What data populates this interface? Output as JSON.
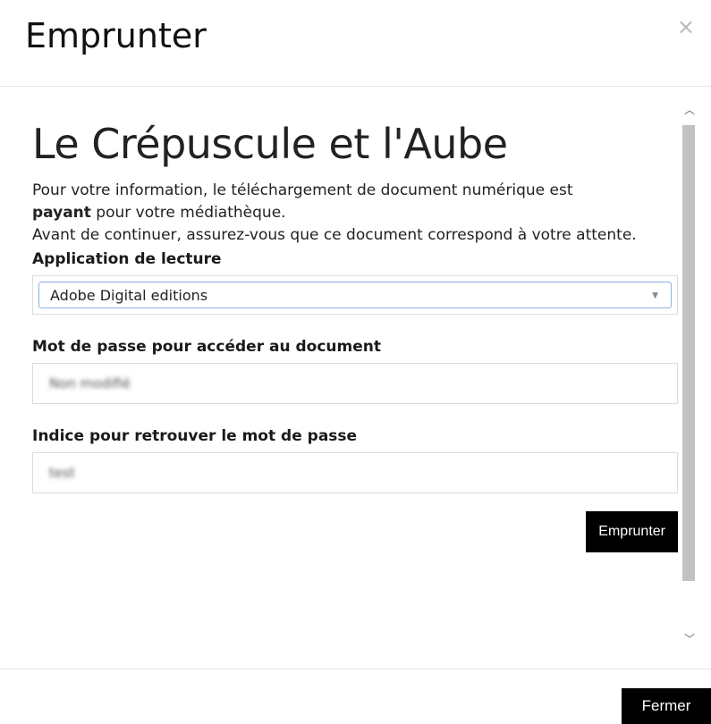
{
  "modal": {
    "title": "Emprunter",
    "close_glyph": "×"
  },
  "book": {
    "title": "Le Crépuscule et l'Aube"
  },
  "info": {
    "line1": "Pour votre information, le téléchargement de document numérique est",
    "bold_word": "payant",
    "line2_rest": " pour votre médiathèque.",
    "line3": "Avant de continuer, assurez-vous que ce document correspond à votre attente."
  },
  "reader_app": {
    "label": "Application de lecture",
    "selected": "Adobe Digital editions"
  },
  "password": {
    "label": "Mot de passe pour accéder au document",
    "value": "Non modifié"
  },
  "hint": {
    "label": "Indice pour retrouver le mot de passe",
    "value": "test"
  },
  "buttons": {
    "borrow": "Emprunter",
    "close": "Fermer"
  },
  "icons": {
    "scroll_up": "chevron-up-icon",
    "scroll_down": "chevron-down-icon",
    "select_caret": "caret-down-icon"
  }
}
